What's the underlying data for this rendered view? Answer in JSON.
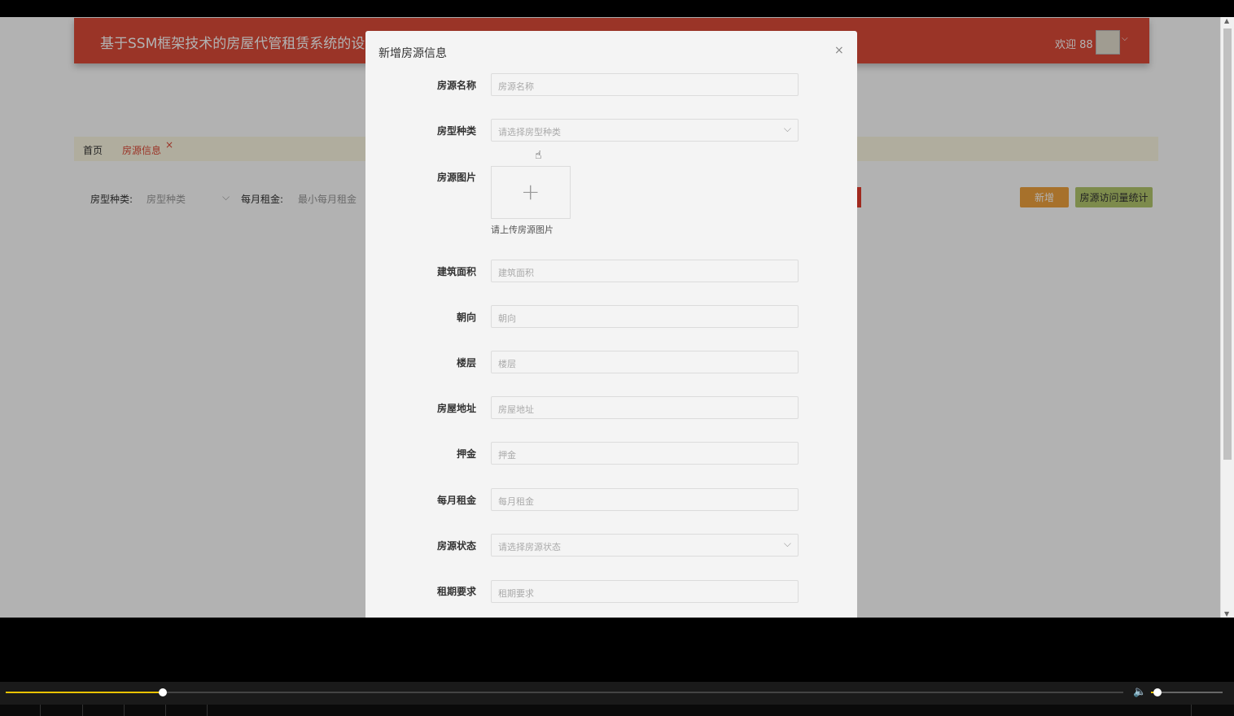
{
  "app": {
    "title": "基于SSM框架技术的房屋代管租赁系统的设",
    "welcome": "欢迎 88"
  },
  "breadcrumb": {
    "home": "首页",
    "current": "房源信息",
    "close": "×"
  },
  "filters": {
    "type_label": "房型种类:",
    "type_placeholder": "房型种类",
    "rent_label": "每月租金:",
    "rent_placeholder": "最小每月租金"
  },
  "actions": {
    "add": "新增",
    "stats": "房源访问量统计"
  },
  "modal": {
    "title": "新增房源信息",
    "close": "×",
    "upload_hint": "请上传房源图片",
    "fields": [
      {
        "label": "房源名称",
        "placeholder": "房源名称"
      },
      {
        "label": "房型种类",
        "placeholder": "请选择房型种类"
      },
      {
        "label": "房源图片"
      },
      {
        "label": "建筑面积",
        "placeholder": "建筑面积"
      },
      {
        "label": "朝向",
        "placeholder": "朝向"
      },
      {
        "label": "楼层",
        "placeholder": "楼层"
      },
      {
        "label": "房屋地址",
        "placeholder": "房屋地址"
      },
      {
        "label": "押金",
        "placeholder": "押金"
      },
      {
        "label": "每月租金",
        "placeholder": "每月租金"
      },
      {
        "label": "房源状态",
        "placeholder": "请选择房源状态"
      },
      {
        "label": "租期要求",
        "placeholder": "租期要求"
      }
    ]
  },
  "colors": {
    "header": "#dd4b39",
    "add_button": "#f0a33e",
    "stats_button": "#b4c76e",
    "progress": "#e8c200"
  },
  "video": {
    "progress": 0.14,
    "volume": 0.09
  }
}
